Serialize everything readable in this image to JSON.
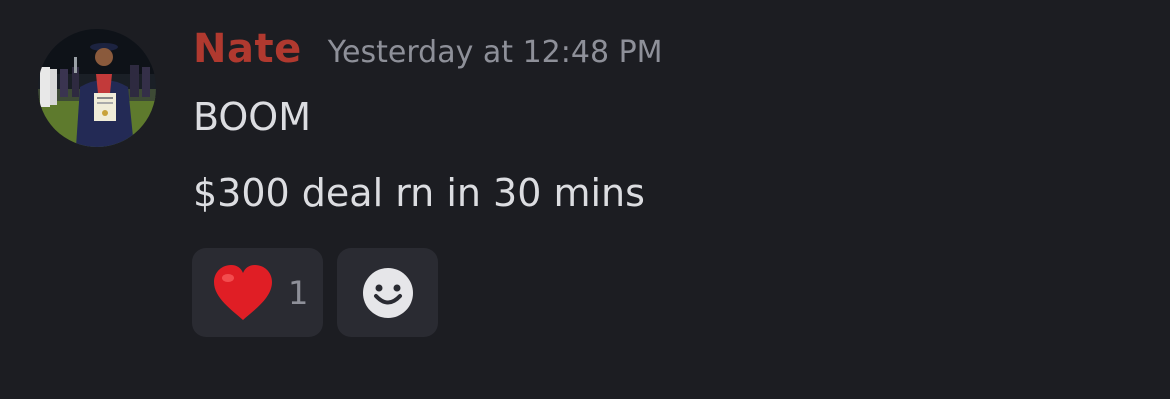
{
  "message": {
    "author": "Nate",
    "timestamp": "Yesterday at 12:48 PM",
    "lines": [
      "BOOM",
      "$300 deal rn in 30 mins"
    ],
    "author_color": "#b0392f"
  },
  "reactions": [
    {
      "emoji": "heart-icon",
      "count": "1"
    },
    {
      "emoji": "add-reaction-icon"
    }
  ],
  "colors": {
    "background": "#1c1d22",
    "reaction_bg": "#2a2b32",
    "text": "#dcdde1",
    "muted": "#8e9099"
  }
}
